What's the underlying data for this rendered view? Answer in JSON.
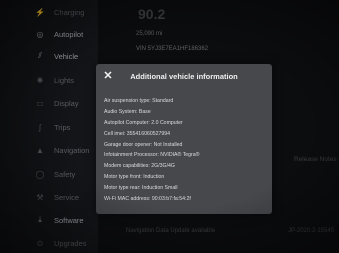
{
  "sidebar": {
    "items": [
      {
        "label": "Charging",
        "icon": "charging-icon"
      },
      {
        "label": "Autopilot",
        "icon": "steering-wheel-icon"
      },
      {
        "label": "Vehicle",
        "icon": "vehicle-icon"
      },
      {
        "label": "Lights",
        "icon": "lights-icon"
      },
      {
        "label": "Display",
        "icon": "display-icon"
      },
      {
        "label": "Trips",
        "icon": "trips-icon"
      },
      {
        "label": "Navigation",
        "icon": "navigation-icon"
      },
      {
        "label": "Safety",
        "icon": "safety-icon"
      },
      {
        "label": "Service",
        "icon": "wrench-icon"
      },
      {
        "label": "Software",
        "icon": "download-icon"
      },
      {
        "label": "Upgrades",
        "icon": "upgrades-icon"
      }
    ]
  },
  "background": {
    "odometer_partial": "90.2",
    "odometer": "25,090 mi",
    "vin": "VIN 5YJ3E7EA1HF186362",
    "release_notes": "Release Notes",
    "nav_update": "Navigation Data Update available",
    "version_partial": "JP-2020.2-15545"
  },
  "modal": {
    "title": "Additional vehicle information",
    "close_glyph": "✕",
    "rows": [
      "Air suspension type: Standard",
      "Audio System: Base",
      "Autopilot Computer: 2.0 Computer",
      "Cell imei: 355416060527994",
      "Garage door opener: Not Installed",
      "Infotainment Processor: NVIDIA® Tegra®",
      "Modem capabilities: 2G/3G/4G",
      "Motor type front: Induction",
      "Motor type rear: Induction Small",
      "Wi-Fi MAC address: 90:03:b7:fa:54:2f"
    ]
  },
  "colors": {
    "modal_bg": "#46484c",
    "screen_bg": "#0c0d0f",
    "text_light": "#dcdde0"
  }
}
